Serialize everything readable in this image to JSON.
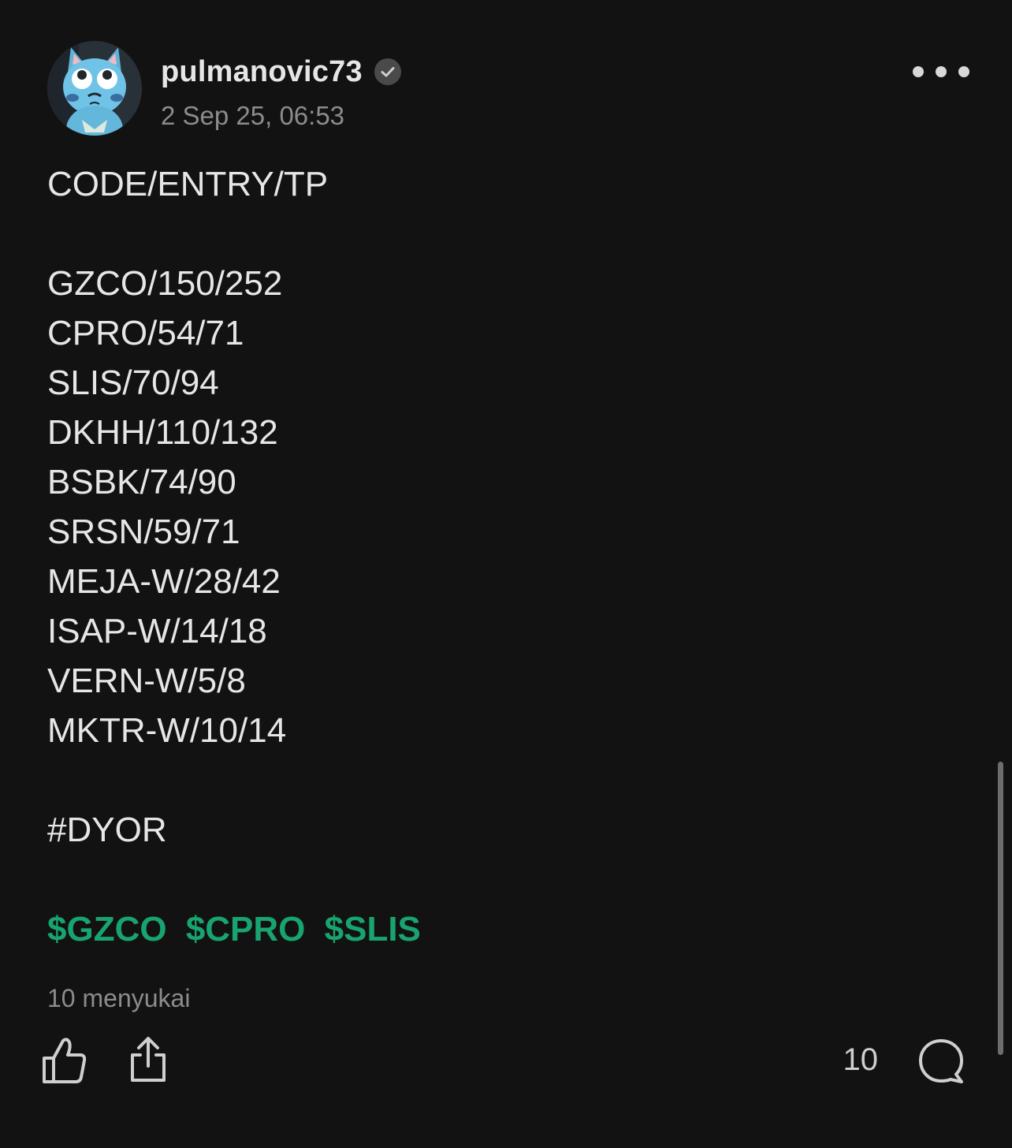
{
  "post": {
    "author": {
      "username": "pulmanovic73",
      "verified": true,
      "avatar_icon": "blue-cat-avatar"
    },
    "timestamp": "2 Sep 25, 06:53",
    "body_lines": [
      "CODE/ENTRY/TP",
      "",
      "GZCO/150/252",
      "CPRO/54/71",
      "SLIS/70/94",
      "DKHH/110/132",
      "BSBK/74/90",
      "SRSN/59/71",
      "MEJA-W/28/42",
      "ISAP-W/14/18",
      "VERN-W/5/8",
      "MKTR-W/10/14",
      "",
      "#DYOR",
      ""
    ],
    "tickers": [
      "$GZCO",
      "$CPRO",
      "$SLIS"
    ],
    "likes_text": "10 menyukai",
    "comment_count": "10"
  },
  "colors": {
    "background": "#121212",
    "text": "#e6e6e6",
    "muted": "#8c8c8c",
    "ticker": "#18a46e"
  },
  "icons": {
    "more": "more-horizontal-icon",
    "like": "thumbs-up-icon",
    "share": "share-icon",
    "comment": "comment-bubble-icon",
    "verified": "verified-badge-icon"
  }
}
